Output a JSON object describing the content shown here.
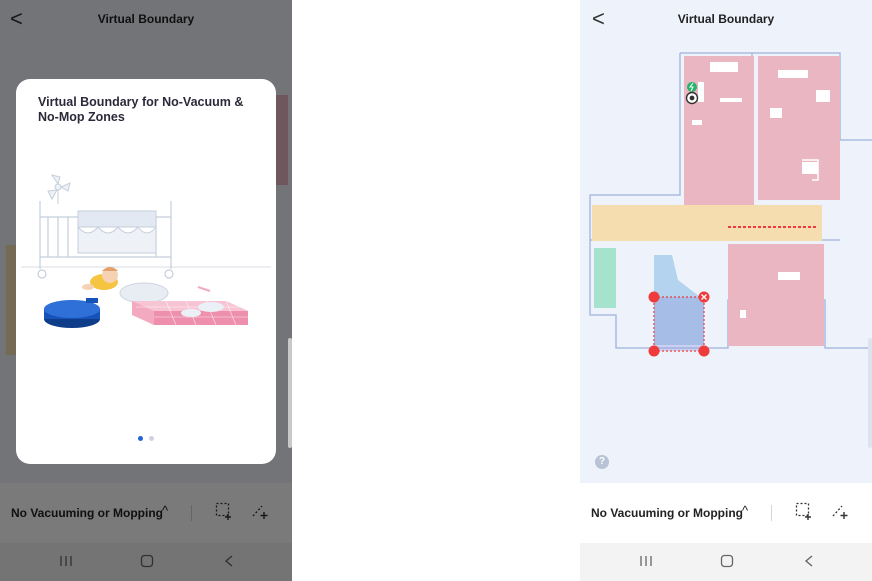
{
  "screen_title": "Virtual Boundary",
  "modal": {
    "title": "Virtual Boundary for No-Vacuum & No-Mop Zones",
    "page_count": 2,
    "active_page": 1
  },
  "mode": {
    "label": "No Vacuuming or Mopping",
    "chevron": "chevron-up-icon"
  },
  "tools": [
    "rectangle-add-icon",
    "line-add-icon"
  ],
  "nav": [
    "recent-apps-icon",
    "home-icon",
    "back-icon"
  ],
  "help_label": "?",
  "colors": {
    "room_pink": "#e9b6c2",
    "corridor_yellow": "#f6ddb0",
    "room_green": "#a6e3cc",
    "room_blue": "#b4d3ef",
    "wall_outline": "#9eb3de",
    "zone_red": "#ef3b3b",
    "accent_blue": "#2563d6"
  }
}
